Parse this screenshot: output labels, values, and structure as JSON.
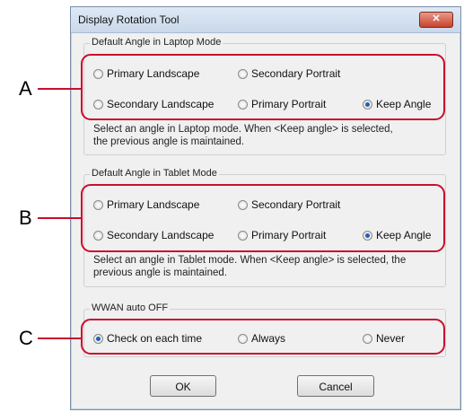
{
  "window": {
    "title": "Display Rotation Tool",
    "close_label": "✕"
  },
  "laptop": {
    "legend": "Default Angle in Laptop Mode",
    "options": [
      "Primary Landscape",
      "Secondary Portrait",
      "Secondary Landscape",
      "Primary Portrait",
      "Keep Angle"
    ],
    "selected": "Keep Angle",
    "help_line1": "Select an angle in Laptop mode. When <Keep angle> is selected,",
    "help_line2": "the previous angle is maintained."
  },
  "tablet": {
    "legend": "Default Angle in Tablet Mode",
    "options": [
      "Primary Landscape",
      "Secondary Portrait",
      "Secondary Landscape",
      "Primary Portrait",
      "Keep Angle"
    ],
    "selected": "Keep Angle",
    "help_line1": "Select an angle in Tablet mode. When <Keep angle> is selected, the",
    "help_line2": "previous angle is maintained."
  },
  "wwan": {
    "legend": "WWAN auto OFF",
    "options": [
      "Check on each time",
      "Always",
      "Never"
    ],
    "selected": "Check on each time"
  },
  "buttons": {
    "ok": "OK",
    "cancel": "Cancel"
  },
  "callouts": [
    "A",
    "B",
    "C"
  ],
  "colors": {
    "highlight": "#c8102e",
    "radio_selected": "#1e5fb8",
    "titlebar": "#c9d8ea"
  }
}
